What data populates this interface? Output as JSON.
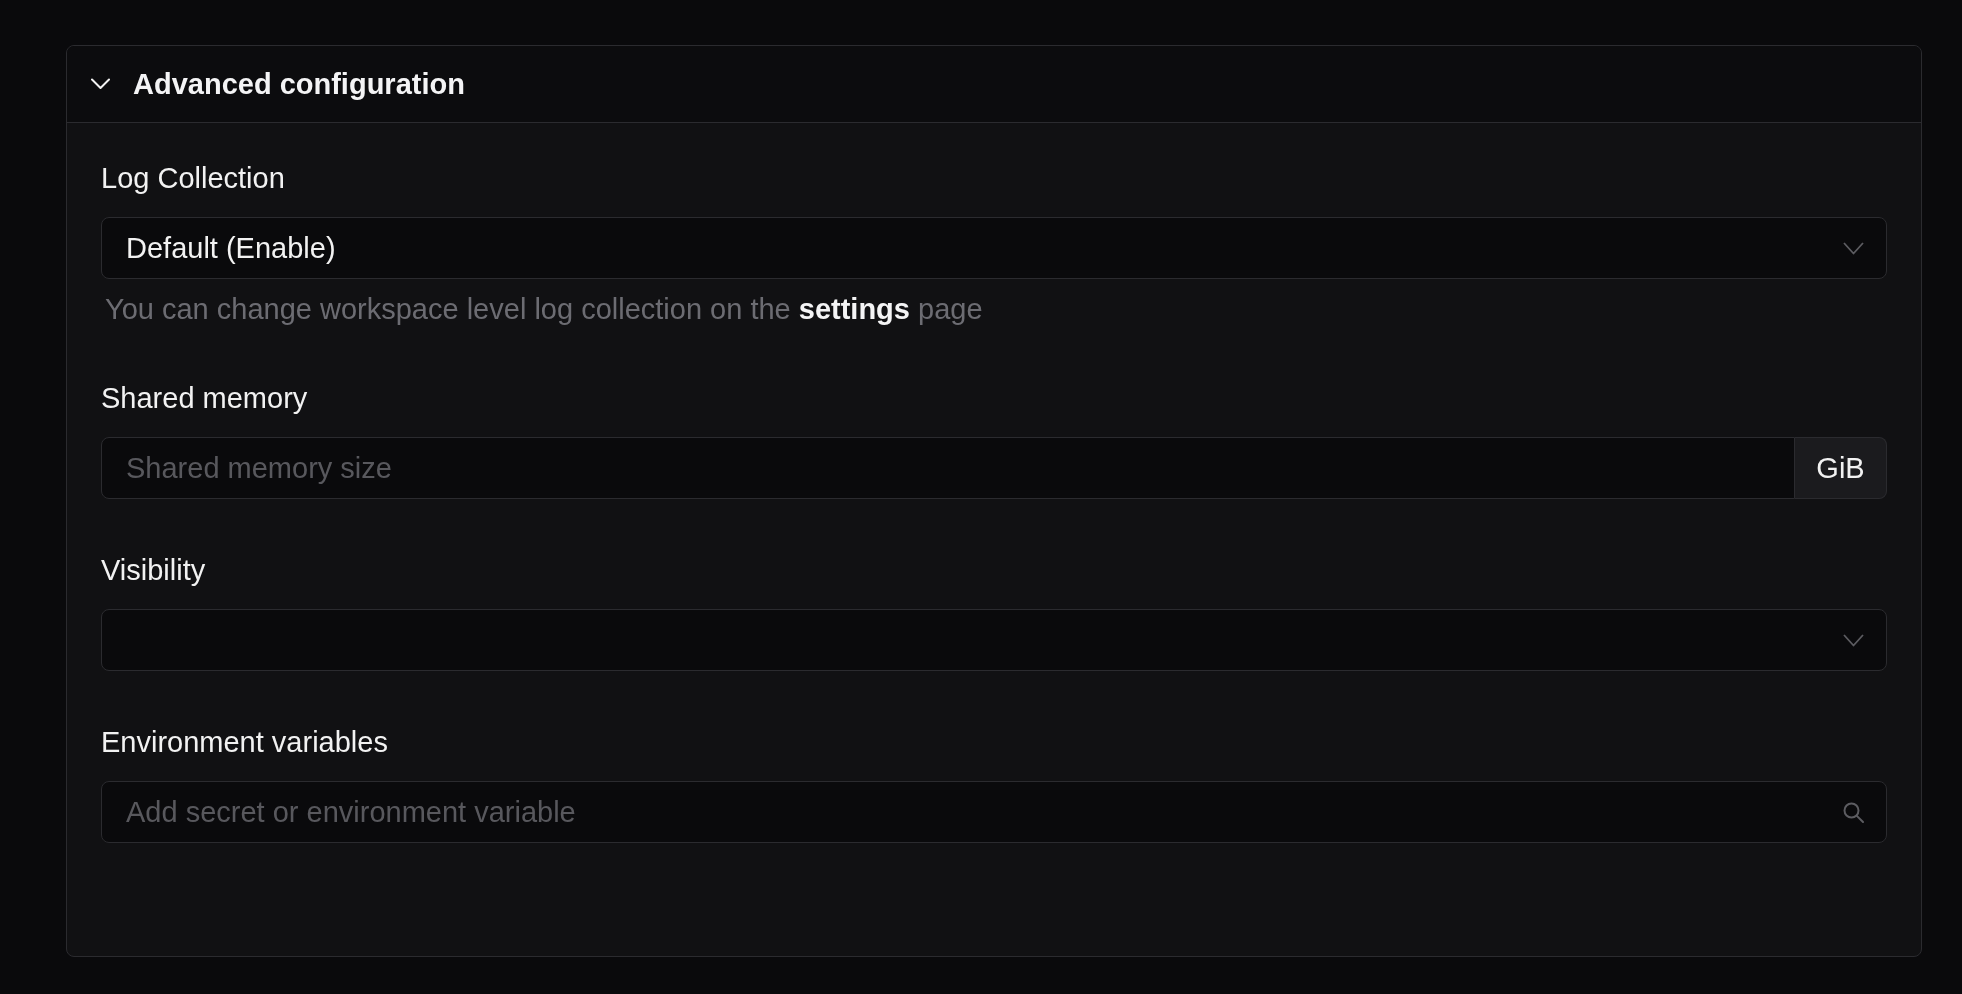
{
  "section": {
    "title": "Advanced configuration",
    "expanded": true
  },
  "fields": [
    {
      "kind": "select",
      "label": "Log Collection",
      "value": "Default (Enable)",
      "helper": {
        "text_before": "You can change workspace level log collection on the",
        "link": "settings",
        "text_after": "page"
      }
    },
    {
      "kind": "addon-input",
      "label": "Shared memory",
      "placeholder": "Shared memory size",
      "addon": "GiB"
    },
    {
      "kind": "select",
      "label": "Visibility"
    },
    {
      "kind": "search",
      "label": "Environment variables",
      "placeholder": "Add secret or environment variable"
    }
  ]
}
